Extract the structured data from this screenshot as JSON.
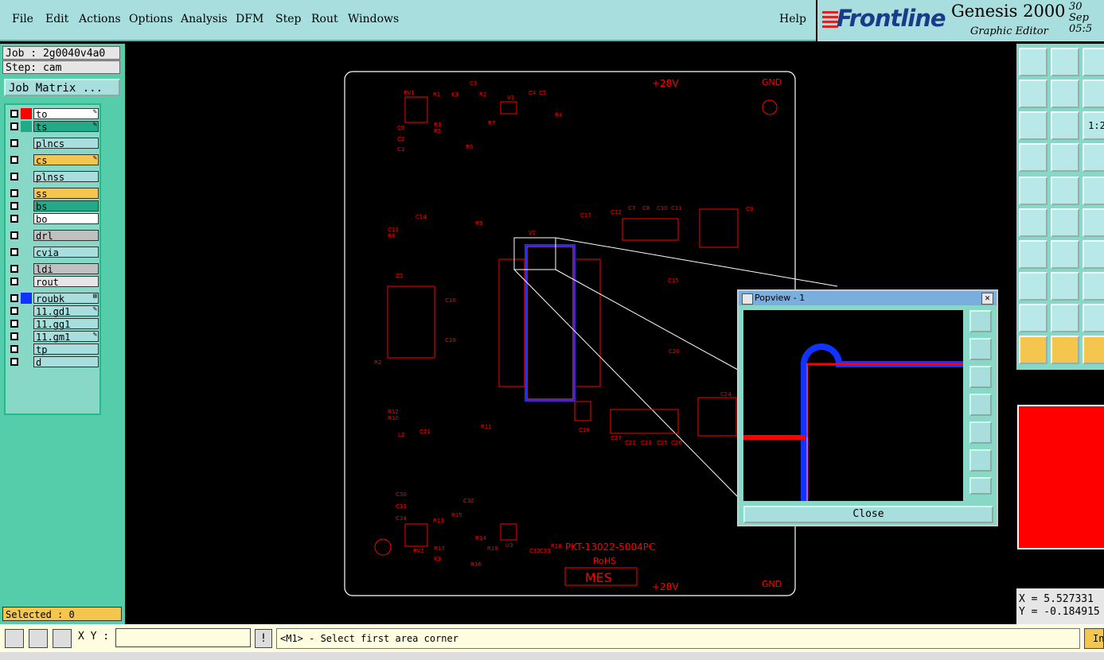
{
  "menu": {
    "items": [
      "File",
      "Edit",
      "Actions",
      "Options",
      "Analysis",
      "DFM",
      "Step",
      "Rout",
      "Windows"
    ],
    "help": "Help"
  },
  "brand": {
    "logo": "Frontline",
    "title": "Genesis 2000",
    "subtitle": "Graphic Editor",
    "date_line1": "30 Sep",
    "date_line2": "05:5"
  },
  "job": {
    "job_label": "Job : 2g0040v4a0",
    "step_label": "Step: cam",
    "matrix_button": "Job Matrix ..."
  },
  "layers": [
    {
      "name": "to",
      "color": "#ff0000",
      "bg": "#ffffff",
      "flag": "✎"
    },
    {
      "name": "ts",
      "color": "#22aa88",
      "bg": "#22aa88",
      "flag": "✎"
    },
    {
      "name": "plncs",
      "color": "",
      "bg": "#a8dede",
      "flag": ""
    },
    {
      "name": "cs",
      "color": "",
      "bg": "#f5c64e",
      "flag": "✎"
    },
    {
      "name": "plnss",
      "color": "",
      "bg": "#a8dede",
      "flag": ""
    },
    {
      "name": "ss",
      "color": "",
      "bg": "#f5c64e",
      "flag": ""
    },
    {
      "name": "bs",
      "color": "",
      "bg": "#22aa88",
      "flag": ""
    },
    {
      "name": "bo",
      "color": "",
      "bg": "#ffffff",
      "flag": ""
    },
    {
      "name": "drl",
      "color": "",
      "bg": "#c0c0c0",
      "flag": ""
    },
    {
      "name": "cvia",
      "color": "",
      "bg": "#a8dede",
      "flag": ""
    },
    {
      "name": "ldi",
      "color": "",
      "bg": "#c0c0c0",
      "flag": ""
    },
    {
      "name": "rout",
      "color": "",
      "bg": "#e6e6e6",
      "flag": ""
    },
    {
      "name": "roubk",
      "color": "#1133ff",
      "bg": "#a8dede",
      "flag": "⊞"
    },
    {
      "name": "11.gd1",
      "color": "",
      "bg": "#a8dede",
      "flag": "✎"
    },
    {
      "name": "11.gg1",
      "color": "",
      "bg": "#a8dede",
      "flag": ""
    },
    {
      "name": "11.gm1",
      "color": "",
      "bg": "#a8dede",
      "flag": "✎"
    },
    {
      "name": "tp",
      "color": "",
      "bg": "#a8dede",
      "flag": ""
    },
    {
      "name": "d",
      "color": "",
      "bg": "#a8dede",
      "flag": ""
    }
  ],
  "selected_label": "Selected : 0",
  "board": {
    "labels_top": [
      "+28V",
      "GND"
    ],
    "labels_bottom": [
      "+28V",
      "GND"
    ],
    "part_number": "PKT-13022-5004PC",
    "rohs": "RoHS",
    "mes": "MES",
    "refdes": [
      "RV1",
      "R1",
      "K3",
      "C3",
      "R2",
      "V1",
      "C4",
      "C5",
      "R4",
      "C6",
      "R3",
      "R5",
      "R7",
      "C2",
      "C1",
      "R6",
      "C12",
      "C7",
      "C8",
      "C10",
      "C11",
      "C9",
      "C17",
      "R9",
      "V2",
      "C14",
      "R8",
      "C13",
      "C15",
      "Z1",
      "C16",
      "C19",
      "R2",
      "C20",
      "C24",
      "R12",
      "R10",
      "L2",
      "C21",
      "C18",
      "R11",
      "C27",
      "C22",
      "C23",
      "C25",
      "C26",
      "C30",
      "C31",
      "C34",
      "C32",
      "R13",
      "R15",
      "R14",
      "R17",
      "R19",
      "K3",
      "R16",
      "U3",
      "C32",
      "C33",
      "R18",
      "RV2"
    ]
  },
  "popview": {
    "title": "Popview - 1",
    "close_button": "Close"
  },
  "right_tools": {
    "zoom_label": "1:2"
  },
  "coords": {
    "x_text": "X = 5.527331",
    "y_text": "Y = -0.184915"
  },
  "bottom": {
    "xy_label": "X Y :",
    "xy_value": "",
    "excl": "!",
    "status": "<M1> - Select first area corner",
    "inst_button": "In"
  },
  "colors": {
    "accent_panel": "#55ccaa",
    "menu_bg": "#a8dede",
    "pcb_red": "#ff0000",
    "rout_blue": "#1133ff",
    "rout_magenta": "#ff33ff"
  }
}
